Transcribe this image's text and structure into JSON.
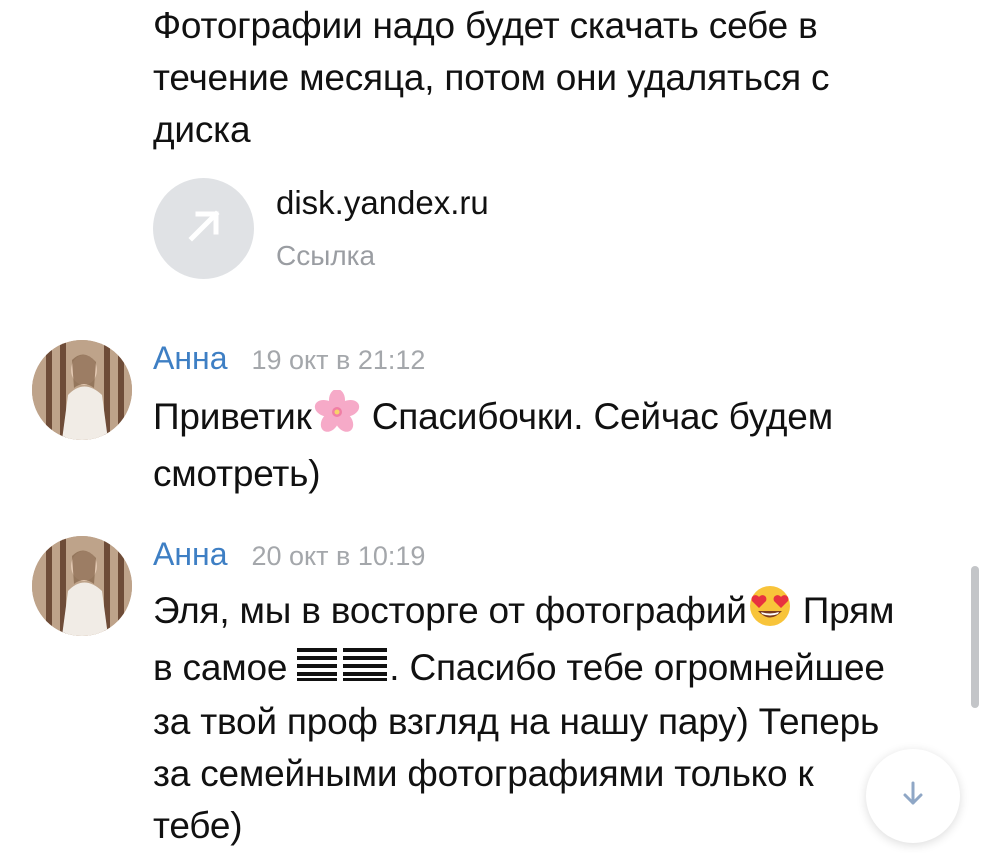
{
  "message_top": {
    "text": "Фотографии надо будет скачать себе в\nтечение месяца, потом они удаляться с\nдиска",
    "link": {
      "title": "disk.yandex.ru",
      "subtitle": "Ссылка",
      "icon": "arrow-up-right-icon"
    }
  },
  "messages": [
    {
      "author": "Анна",
      "time": "19 окт в 21:12",
      "text_part1": "Приветик",
      "emoji1": "cherry-blossom-emoji",
      "text_part2": " Спасибочки. Сейчас будем\nсмотреть)"
    },
    {
      "author": "Анна",
      "time": "20 окт в 10:19",
      "text_part1": "Эля, мы в восторге от фотографий",
      "emoji1": "heart-eyes-emoji",
      "text_part2": " Прям\nв самое ",
      "emoji2": "broken-glyph-emoji",
      "text_part3": ". Спасибо тебе огромнейшее\nза твой проф взгляд на нашу пару) Теперь\nза семейными фотографиями только к\nтебе)"
    }
  ],
  "colors": {
    "author": "#3e7fc4",
    "timestamp": "#a4a7ab",
    "link_circle": "#e0e2e5",
    "link_subtitle": "#9a9da2"
  },
  "controls": {
    "scroll_down_icon": "chevron-down-icon"
  }
}
